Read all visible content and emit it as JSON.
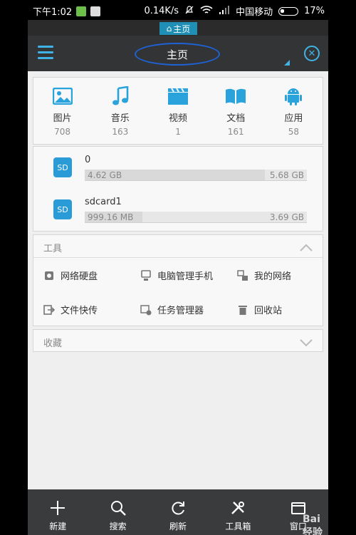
{
  "status_bar": {
    "time": "下午1:02",
    "speed": "0.14K/s",
    "carrier": "中国移动",
    "battery": "17%"
  },
  "tab": {
    "label": "主页"
  },
  "appbar": {
    "title": "主页"
  },
  "categories": [
    {
      "label": "图片",
      "count": "708",
      "icon": "image-icon"
    },
    {
      "label": "音乐",
      "count": "163",
      "icon": "music-icon"
    },
    {
      "label": "视频",
      "count": "1",
      "icon": "video-icon"
    },
    {
      "label": "文档",
      "count": "161",
      "icon": "document-icon"
    },
    {
      "label": "应用",
      "count": "58",
      "icon": "android-icon"
    }
  ],
  "storage": [
    {
      "name": "0",
      "used": "4.62 GB",
      "total": "5.68 GB",
      "fill": 0.81,
      "icon_text": "SD"
    },
    {
      "name": "sdcard1",
      "used": "999.16 MB",
      "total": "3.69 GB",
      "fill": 0.26,
      "icon_text": "SD"
    }
  ],
  "tools": {
    "title": "工具",
    "items": [
      {
        "label": "网络硬盘",
        "icon": "cloud-disk-icon"
      },
      {
        "label": "电脑管理手机",
        "icon": "pc-manage-icon"
      },
      {
        "label": "我的网络",
        "icon": "network-icon"
      },
      {
        "label": "文件快传",
        "icon": "file-transfer-icon"
      },
      {
        "label": "任务管理器",
        "icon": "task-manager-icon"
      },
      {
        "label": "回收站",
        "icon": "trash-icon"
      }
    ]
  },
  "favorites": {
    "title": "收藏"
  },
  "bottom_bar": [
    {
      "label": "新建",
      "icon": "plus-icon"
    },
    {
      "label": "搜索",
      "icon": "search-icon"
    },
    {
      "label": "刷新",
      "icon": "refresh-icon"
    },
    {
      "label": "工具箱",
      "icon": "tools-icon"
    },
    {
      "label": "窗口",
      "icon": "window-icon"
    }
  ],
  "watermark": "Bai 经验",
  "colors": {
    "accent": "#3fb3e6",
    "appbar": "#333436",
    "bottom_bar": "#3a3b3d"
  }
}
